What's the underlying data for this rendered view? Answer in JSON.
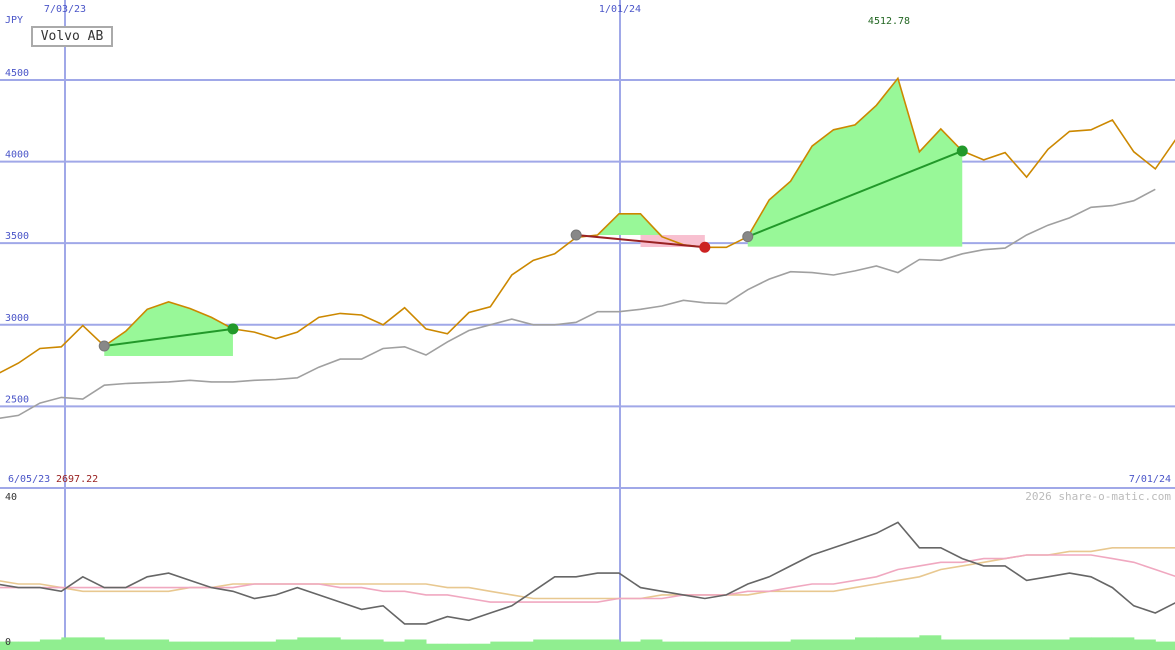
{
  "chart_data": {
    "type": "line",
    "title": "Volvo AB",
    "currency": "JPY",
    "watermark": "2026 share-o-matic.com",
    "date_range": {
      "start": "6/05/23",
      "end": "7/01/24"
    },
    "x_tick_labels": [
      "7/03/23",
      "1/01/24"
    ],
    "y_tick_labels": [
      "4500",
      "4000",
      "3500",
      "3000",
      "2500"
    ],
    "ylim": [
      2000,
      4990
    ],
    "max_label": "4512.78",
    "min_label": "2697.22",
    "grid": true,
    "main_series": [
      {
        "name": "",
        "color": "#cc8800",
        "x": [
          0,
          1,
          2,
          3,
          4,
          5,
          6,
          7,
          8,
          9,
          10,
          11,
          12,
          13,
          14,
          15,
          16,
          17,
          18,
          19,
          20,
          21,
          22,
          23,
          24,
          25,
          26,
          27,
          28,
          29,
          30,
          31,
          32,
          33,
          34,
          35,
          36,
          37,
          38,
          39,
          40,
          41,
          42,
          43,
          44,
          45,
          46,
          47,
          48,
          49,
          50,
          51,
          52,
          53,
          54
        ],
        "values": [
          2697,
          2765,
          2855,
          2865,
          2995,
          2870,
          2960,
          3095,
          3140,
          3100,
          3045,
          2975,
          2955,
          2915,
          2955,
          3045,
          3070,
          3060,
          3000,
          3105,
          2975,
          2945,
          3075,
          3110,
          3305,
          3395,
          3435,
          3535,
          3550,
          3680,
          3680,
          3540,
          3490,
          3475,
          3475,
          3540,
          3765,
          3880,
          4095,
          4195,
          4225,
          4345,
          4510,
          4060,
          4200,
          4065,
          4010,
          4055,
          3905,
          4075,
          4185,
          4195,
          4255,
          4060,
          3955,
          4145
        ]
      },
      {
        "name": "",
        "color": "#a0a0a0",
        "x": [
          0,
          1,
          2,
          3,
          4,
          5,
          6,
          7,
          8,
          9,
          10,
          11,
          12,
          13,
          14,
          15,
          16,
          17,
          18,
          19,
          20,
          21,
          22,
          23,
          24,
          25,
          26,
          27,
          28,
          29,
          30,
          31,
          32,
          33,
          34,
          35,
          36,
          37,
          38,
          39,
          40,
          41,
          42,
          43,
          44,
          45,
          46,
          47,
          48,
          49,
          50,
          51,
          52,
          53,
          54
        ],
        "values": [
          2425,
          2445,
          2520,
          2555,
          2545,
          2630,
          2640,
          2645,
          2650,
          2660,
          2650,
          2650,
          2660,
          2665,
          2675,
          2740,
          2790,
          2790,
          2855,
          2865,
          2815,
          2895,
          2965,
          3000,
          3035,
          3000,
          3000,
          3015,
          3080,
          3080,
          3095,
          3115,
          3150,
          3135,
          3130,
          3215,
          3280,
          3325,
          3320,
          3305,
          3330,
          3360,
          3320,
          3400,
          3395,
          3435,
          3460,
          3470,
          3550,
          3610,
          3655,
          3720,
          3730,
          3760,
          3830
        ]
      }
    ],
    "signals": [
      {
        "from_x": 5,
        "from_value": 2870,
        "to_x": 11,
        "to_value": 2975,
        "result": "gain"
      },
      {
        "from_x": 27,
        "from_value": 3550,
        "to_x": 33,
        "to_value": 3475,
        "result": "loss"
      },
      {
        "from_x": 35,
        "from_value": 3540,
        "to_x": 45,
        "to_value": 4065,
        "result": "gain"
      }
    ],
    "indicator": {
      "y_tick_labels": [
        "40",
        "0"
      ],
      "ylim": [
        0,
        40
      ],
      "series": [
        {
          "name": "",
          "color": "#666666",
          "values": [
            16,
            15,
            15,
            14,
            18,
            15,
            15,
            18,
            19,
            17,
            15,
            14,
            12,
            13,
            15,
            13,
            11,
            9,
            10,
            5,
            5,
            7,
            6,
            8,
            10,
            14,
            18,
            18,
            19,
            19,
            15,
            14,
            13,
            12,
            13,
            16,
            18,
            21,
            24,
            26,
            28,
            30,
            33,
            26,
            26,
            23,
            21,
            21,
            17,
            18,
            19,
            18,
            15,
            10,
            8,
            11
          ]
        },
        {
          "name": "",
          "color": "#f0a8c0",
          "values": [
            15,
            15,
            15,
            15,
            15,
            15,
            15,
            15,
            15,
            15,
            15,
            15,
            16,
            16,
            16,
            16,
            15,
            15,
            14,
            14,
            13,
            13,
            12,
            11,
            11,
            11,
            11,
            11,
            11,
            12,
            12,
            12,
            13,
            13,
            13,
            14,
            14,
            15,
            16,
            16,
            17,
            18,
            20,
            21,
            22,
            22,
            23,
            23,
            24,
            24,
            24,
            24,
            23,
            22,
            20,
            18
          ]
        },
        {
          "name": "",
          "color": "#e8c890",
          "values": [
            17,
            16,
            16,
            15,
            14,
            14,
            14,
            14,
            14,
            15,
            15,
            16,
            16,
            16,
            16,
            16,
            16,
            16,
            16,
            16,
            16,
            15,
            15,
            14,
            13,
            12,
            12,
            12,
            12,
            12,
            12,
            13,
            13,
            13,
            13,
            13,
            14,
            14,
            14,
            14,
            15,
            16,
            17,
            18,
            20,
            21,
            22,
            23,
            24,
            24,
            25,
            25,
            26,
            26,
            26,
            26
          ]
        }
      ],
      "volume": [
        4,
        4,
        5,
        6,
        6,
        5,
        5,
        5,
        4,
        4,
        4,
        4,
        4,
        5,
        6,
        6,
        5,
        5,
        4,
        5,
        3,
        3,
        3,
        4,
        4,
        5,
        5,
        5,
        5,
        4,
        5,
        4,
        4,
        4,
        4,
        4,
        4,
        5,
        5,
        5,
        6,
        6,
        6,
        7,
        5,
        5,
        5,
        5,
        5,
        5,
        6,
        6,
        6,
        5,
        4
      ]
    },
    "colors": {
      "gain_fill": "#98f898",
      "loss_fill": "#f8c0d0",
      "gain_line": "#22992a",
      "loss_line": "#992222",
      "grid": "#a0a8e8",
      "max_label": "#226622",
      "min_label": "#992222",
      "axis_labels": "#4a55c8"
    }
  }
}
